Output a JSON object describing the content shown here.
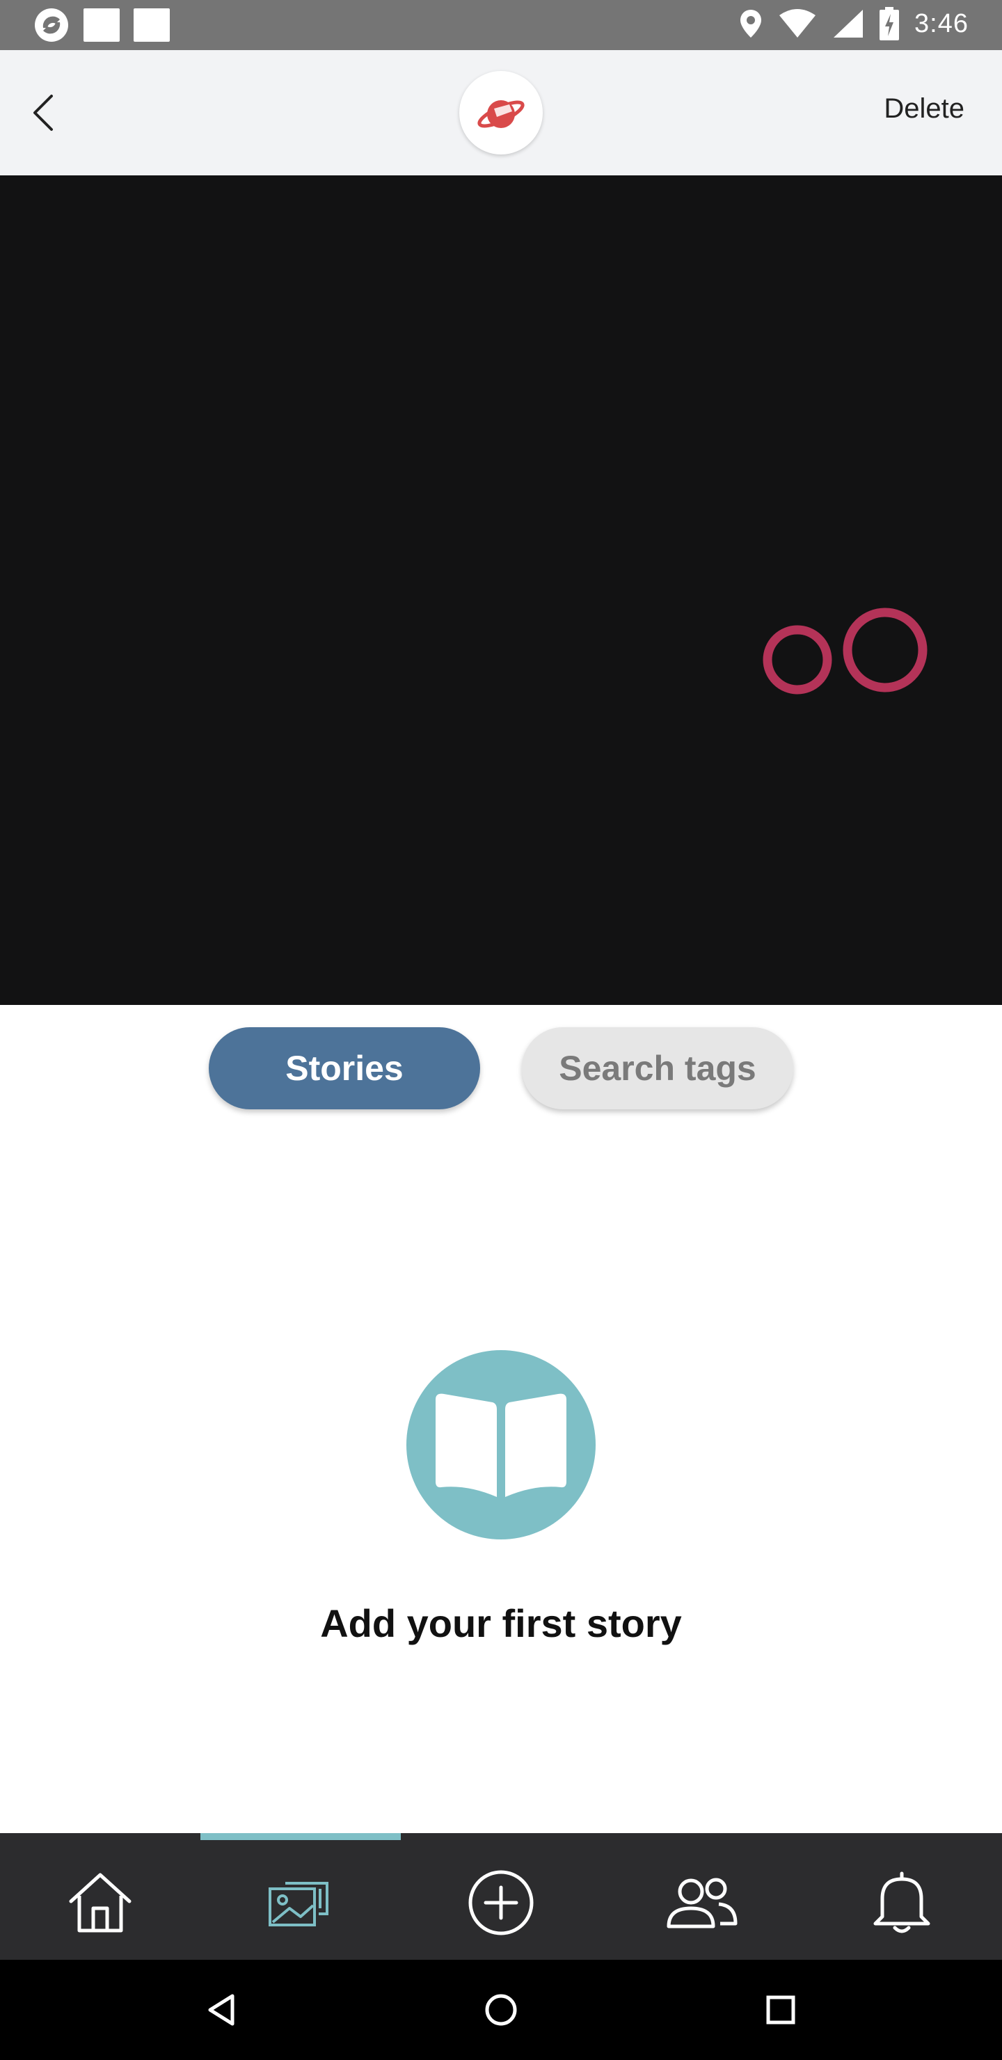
{
  "status_bar": {
    "time": "3:46",
    "icons": [
      "app-notification-icon",
      "square-notification-icon",
      "square-notification-icon",
      "location-icon",
      "wifi-icon",
      "signal-icon",
      "battery-charging-icon"
    ]
  },
  "header": {
    "delete_label": "Delete",
    "logo_icon": "red-planet-logo"
  },
  "media": {
    "background": "#121213",
    "art_color": "#c2365e"
  },
  "segments": {
    "stories_label": "Stories",
    "tags_label": "Search tags",
    "active": "Stories"
  },
  "empty_state": {
    "icon": "open-book-icon",
    "title": "Add your first story"
  },
  "bottom_nav": {
    "items": [
      "home-icon",
      "gallery-icon",
      "add-circle-icon",
      "people-icon",
      "bell-icon"
    ],
    "active_index": 1,
    "accent": "#7ebfc6"
  },
  "colors": {
    "primary_button": "#4d7399",
    "accent": "#7ebfc6",
    "brand_red": "#d94a4a"
  }
}
